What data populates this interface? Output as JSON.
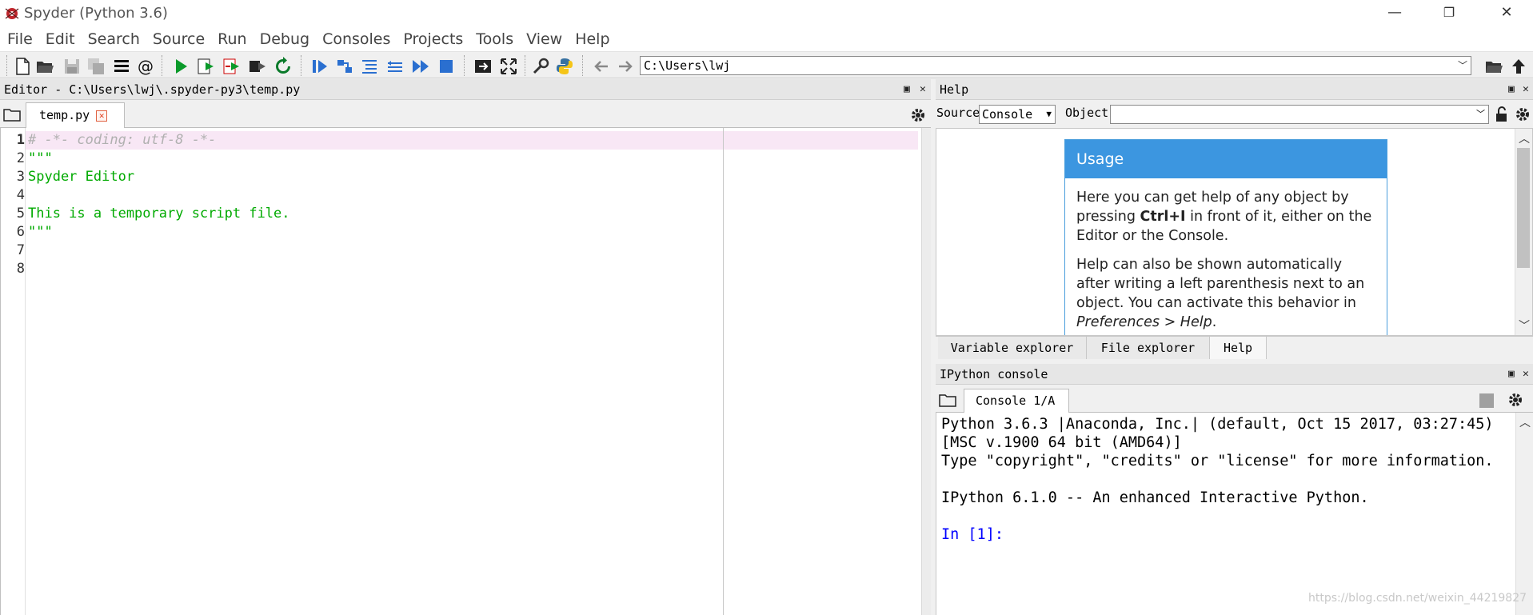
{
  "window": {
    "title": "Spyder (Python 3.6)",
    "minimize": "—",
    "restore": "❐",
    "close": "✕"
  },
  "menu": [
    "File",
    "Edit",
    "Search",
    "Source",
    "Run",
    "Debug",
    "Consoles",
    "Projects",
    "Tools",
    "View",
    "Help"
  ],
  "toolbar": {
    "working_directory": "C:\\Users\\lwj"
  },
  "editor": {
    "title": "Editor - C:\\Users\\lwj\\.spyder-py3\\temp.py",
    "tab": "temp.py",
    "line_numbers": [
      "1",
      "2",
      "3",
      "4",
      "5",
      "6",
      "7",
      "8"
    ],
    "lines": [
      "# -*- coding: utf-8 -*-",
      "\"\"\"",
      "Spyder Editor",
      "",
      "This is a temporary script file.",
      "\"\"\"",
      "",
      ""
    ],
    "comment_color": "#b0b0b0",
    "string_color": "#00aa00"
  },
  "help": {
    "title": "Help",
    "source_label": "Source",
    "source_value": "Console",
    "object_label": "Object",
    "object_value": "",
    "usage_title": "Usage",
    "p1_a": "Here you can get help of any object by pressing ",
    "p1_b": "Ctrl+I",
    "p1_c": " in front of it, either on the Editor or the Console.",
    "p2_a": "Help can also be shown automatically after writing a left parenthesis next to an object. You can activate this behavior in ",
    "p2_b": "Preferences > Help",
    "p2_c": ".",
    "tabs": [
      "Variable explorer",
      "File explorer",
      "Help"
    ]
  },
  "console": {
    "title": "IPython console",
    "tab": "Console 1/A",
    "lines": [
      "Python 3.6.3 |Anaconda, Inc.| (default, Oct 15 2017, 03:27:45)",
      "[MSC v.1900 64 bit (AMD64)]",
      "Type \"copyright\", \"credits\" or \"license\" for more information.",
      "",
      "IPython 6.1.0 -- An enhanced Interactive Python.",
      "",
      "In [1]:"
    ],
    "prompt_color": "#0000ff"
  },
  "watermark": "https://blog.csdn.net/weixin_44219827"
}
